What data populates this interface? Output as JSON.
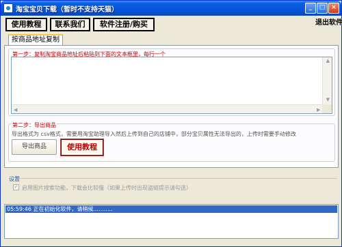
{
  "window": {
    "title": "淘宝宝贝下载（暂时不支持天猫）",
    "controls": {
      "minimize": "_",
      "maximize": "□",
      "close": "×"
    }
  },
  "toolbar": {
    "tutorial": "使用教程",
    "contact": "联系我们",
    "register": "软件注册/购买",
    "exit": "退出软件"
  },
  "tab": {
    "label": "按商品地址复制"
  },
  "step1": {
    "title": "第一步：复制淘宝商品地址后粘贴到下面的文本框里，每行一个",
    "textarea_value": ""
  },
  "step2": {
    "title": "第二步：导出商品",
    "description": "导出格式为 csv格式，需要用淘宝助理导入然后上传到自己的店铺中，部分宝贝属性无法导出的，上传时需要手动修改",
    "export_button": "导出商品",
    "tutorial_button": "使用教程"
  },
  "settings": {
    "label": "设置",
    "checkbox_label": "启用图片搜索功能，下载会比较慢（如果上传时出现盗链提示请勾选）",
    "checkbox_checked": true
  },
  "log": {
    "lines": [
      "05:59:46 正在初始化软件，请稍候..........."
    ]
  },
  "colors": {
    "step_title": "#c00000",
    "log_highlight": "#316ac5",
    "titlebar": "#0553d9"
  }
}
